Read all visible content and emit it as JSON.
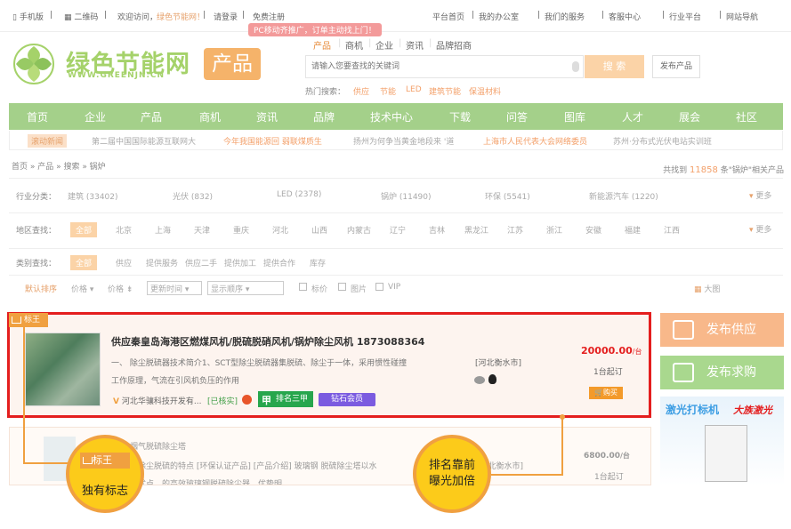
{
  "topbar": {
    "mobile": "手机版",
    "qrcode": "二维码",
    "welcome": "欢迎访问，",
    "site": "绿色节能网！",
    "login": "请登录",
    "register": "免费注册",
    "links": [
      "平台首页",
      "我的办公室",
      "我们的服务",
      "客服中心",
      "行业平台",
      "网站导航"
    ]
  },
  "promo": "PC移动齐推广，订单主动找上门！",
  "logo": {
    "text": "绿色节能网",
    "url": "WWW.GREENJN.CN",
    "badge": "产品"
  },
  "search": {
    "tabs": [
      "产品",
      "商机",
      "企业",
      "资讯",
      "品牌招商"
    ],
    "placeholder": "请输入您要查找的关键词",
    "button": "搜 索",
    "publish": "发布产品"
  },
  "hot": {
    "label": "热门搜索：",
    "items": [
      "供应",
      "节能",
      "LED",
      "建筑节能",
      "保温材料"
    ]
  },
  "nav": [
    "首页",
    "企业",
    "产品",
    "商机",
    "资讯",
    "品牌",
    "技术中心",
    "下载",
    "问答",
    "图库",
    "人才",
    "展会",
    "社区"
  ],
  "ticker": [
    "滚动新闻",
    "第二届中国国际能源互联网大",
    "今年我国能源回 弱联煤质生",
    "扬州为何争当黄金地段来 '道",
    "上海市人民代表大会网络委员",
    "苏州·分布式光伏电站实训班"
  ],
  "breadcrumb": "首页 » 产品 » 搜索 » 锅炉",
  "found": {
    "prefix": "共找到",
    "count": "11858",
    "suffix": "条\"锅炉\"相关产品"
  },
  "filters": {
    "industry": {
      "label": "行业分类：",
      "items": [
        "建筑 (33402)",
        "光伏 (832)",
        "LED (2378)",
        "锅炉 (11490)",
        "环保 (5541)",
        "新能源汽车 (1220)"
      ],
      "more": "更多"
    },
    "region": {
      "label": "地区查找：",
      "selected": "全部",
      "items": [
        "北京",
        "上海",
        "天津",
        "重庆",
        "河北",
        "山西",
        "内蒙古",
        "辽宁",
        "吉林",
        "黑龙江",
        "江苏",
        "浙江",
        "安徽",
        "福建",
        "江西"
      ],
      "more": "更多"
    },
    "type": {
      "label": "类别查找：",
      "selected": "全部",
      "items": [
        "供应",
        "提供服务",
        "供应二手",
        "提供加工",
        "提供合作",
        "库存"
      ]
    }
  },
  "sort": {
    "default": "默认排序",
    "price1": "价格",
    "price2": "价格",
    "time": "更新时间",
    "display": "显示顺序",
    "options": [
      "标价",
      "图片",
      "VIP"
    ],
    "bigimg": "大图"
  },
  "listing1": {
    "badge": "标王",
    "title": "供应秦皇岛海港区燃煤风机/脱硫脱硝风机/锅炉除尘风机 1873088364",
    "desc": "一、 除尘脱硫器技术简介1、SCT型除尘脱硫器集脱硫、除尘于一体，采用惯性碰撞",
    "desc2": "工作原理，气流在引风机负压的作用",
    "company": "河北华骧科技开发有...",
    "verified": "[已核实]",
    "rank": "排名三甲",
    "rank_icon": "甲",
    "member": "钻石会员",
    "location": "[河北衡水市]",
    "price": "20000.00",
    "unit": "/台",
    "moq": "1台起订",
    "buy": "购买"
  },
  "listing2": {
    "title": "烟气脱硫除尘塔",
    "desc": "脱除尘脱硫的特点 [环保认证产品] [产品介绍] 玻璃钢 脱硫除尘塔以水",
    "desc2": "等优点，的高效玻璃钢脱硫除尘器，优势明",
    "location": "[河北衡水市]",
    "price": "6800.00",
    "unit": "/台",
    "moq": "1台起订"
  },
  "sidebar": {
    "supply": "发布供应",
    "purchase": "发布求购",
    "ad_t1": "激光打标机",
    "ad_t2": "大族激光"
  },
  "callouts": {
    "left_badge": "标王",
    "left_text": "独有标志",
    "right_text1": "排名靠前",
    "right_text2": "曝光加倍"
  },
  "colors": {
    "accent": "#f0a040",
    "nav": "#a4d08a",
    "highlight": "#e41e1e"
  }
}
